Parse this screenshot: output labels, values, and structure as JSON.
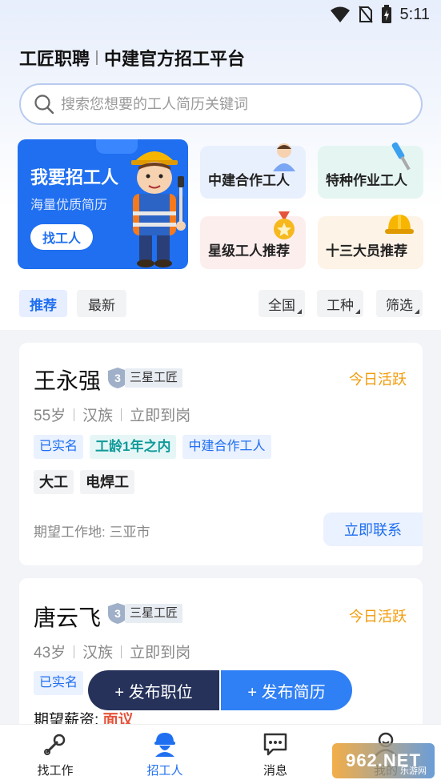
{
  "status": {
    "time": "5:11"
  },
  "header": {
    "brand": "工匠职聘",
    "slogan": "中建官方招工平台"
  },
  "search": {
    "placeholder": "搜索您想要的工人简历关键词"
  },
  "hero": {
    "title": "我要招工人",
    "subtitle": "海量优质简历",
    "button": "找工人"
  },
  "categories": [
    {
      "label": "中建合作工人",
      "icon": "person-icon"
    },
    {
      "label": "特种作业工人",
      "icon": "screwdriver-icon"
    },
    {
      "label": "星级工人推荐",
      "icon": "medal-icon"
    },
    {
      "label": "十三大员推荐",
      "icon": "hardhat-icon"
    }
  ],
  "filters": {
    "tabs": [
      "推荐",
      "最新"
    ],
    "dropdowns": [
      "全国",
      "工种",
      "筛选"
    ]
  },
  "workers": [
    {
      "name": "王永强",
      "level": "3",
      "badge": "三星工匠",
      "activity": "今日活跃",
      "age": "55岁",
      "ethnicity": "汉族",
      "availability": "立即到岗",
      "tags": [
        "已实名",
        "工龄1年之内",
        "中建合作工人"
      ],
      "skills": [
        "大工",
        "电焊工"
      ],
      "location": "期望工作地: 三亚市",
      "contact": "立即联系"
    },
    {
      "name": "唐云飞",
      "level": "3",
      "badge": "三星工匠",
      "activity": "今日活跃",
      "age": "43岁",
      "ethnicity": "汉族",
      "availability": "立即到岗",
      "tags": [
        "已实名"
      ],
      "salary_label": "期望薪资:",
      "salary_value": "面议"
    }
  ],
  "fab": {
    "post_job": "+ 发布职位",
    "post_resume": "+ 发布简历"
  },
  "tabbar": [
    {
      "label": "找工作",
      "icon": "wrench-icon"
    },
    {
      "label": "招工人",
      "icon": "worker-icon"
    },
    {
      "label": "消息",
      "icon": "message-icon"
    },
    {
      "label": "我的",
      "icon": "profile-icon"
    }
  ],
  "watermark": {
    "text": "962.NET",
    "sub": "乐游网"
  },
  "colors": {
    "primary": "#1f6ff0",
    "active": "#f29b0a",
    "salary": "#e5533b",
    "fab_dark": "#26325a"
  }
}
